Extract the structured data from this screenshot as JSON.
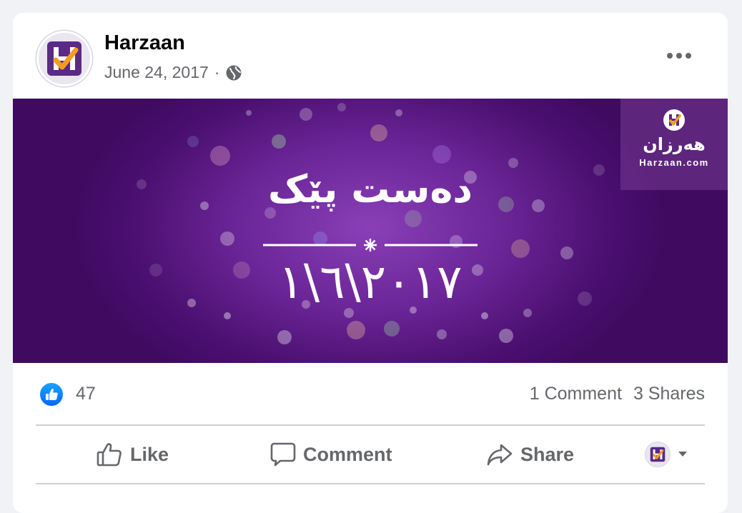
{
  "post": {
    "page_name": "Harzaan",
    "date": "June 24, 2017",
    "meta_separator": "·",
    "audience_icon": "globe-icon",
    "more_icon": "more-options-icon"
  },
  "banner": {
    "title": "دەست پێک",
    "date": "٢٠١٧\\٦\\١",
    "logo_text": "هەرزان",
    "logo_url": "Harzaan.com"
  },
  "stats": {
    "reaction_icon": "like-reaction-icon",
    "reaction_count": "47",
    "comments": "1 Comment",
    "shares": "3 Shares"
  },
  "actions": {
    "like_label": "Like",
    "comment_label": "Comment",
    "share_label": "Share"
  },
  "colors": {
    "brand_purple": "#5b2a86",
    "brand_orange": "#f39c1f",
    "like_blue": "#0866ff",
    "secondary_text": "#65676b"
  }
}
